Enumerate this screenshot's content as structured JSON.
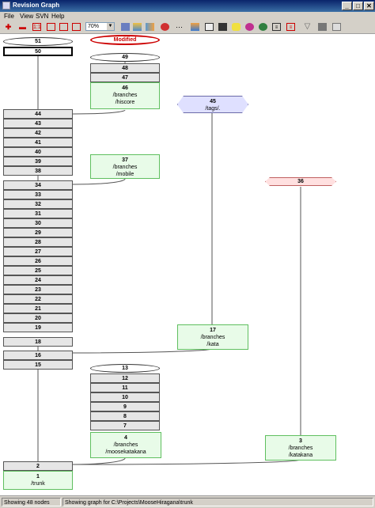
{
  "window": {
    "title": "Revision Graph",
    "controls": [
      "_",
      "□",
      "✕"
    ]
  },
  "menu": [
    "File",
    "View",
    "SVN",
    "Help"
  ],
  "toolbar": {
    "zoom": "70%"
  },
  "status": {
    "left": "Showing 48 nodes",
    "right": "Showing graph for C:\\Projects\\MooseHiragana\\trunk"
  },
  "colors": {
    "copy_fill": "#e8fbe8",
    "copy_border": "#5fbf5f",
    "modified": "#cc0000",
    "tag_fill": "#dfe0ff",
    "deleted_fill": "#ffe0e0"
  },
  "graph": {
    "modified_label": "Modified",
    "trunk_top": [
      "51",
      "50"
    ],
    "trunk_mid": [
      "44",
      "43",
      "42",
      "41",
      "40",
      "39",
      "38"
    ],
    "trunk_low": [
      "34",
      "33",
      "32",
      "31",
      "30",
      "29",
      "28",
      "27",
      "26",
      "25",
      "24",
      "23",
      "22",
      "21",
      "20",
      "19",
      "18"
    ],
    "trunk_bot": [
      "16",
      "15"
    ],
    "trunk_end": "2",
    "trunk_root": {
      "rev": "1",
      "path": "/trunk"
    },
    "hiscore_stack": [
      "49",
      "48",
      "47"
    ],
    "hiscore": {
      "rev": "46",
      "path1": "/branches",
      "path2": "/hiscore"
    },
    "mobile": {
      "rev": "37",
      "path1": "/branches",
      "path2": "/mobile"
    },
    "tag": {
      "rev": "45",
      "path": "/tags/."
    },
    "deleted": {
      "rev": "36"
    },
    "kata": {
      "rev": "17",
      "path1": "/branches",
      "path2": "/kata"
    },
    "moose_stack": [
      "13",
      "12",
      "11",
      "10",
      "9",
      "8",
      "7"
    ],
    "moose": {
      "rev": "4",
      "path1": "/branches",
      "path2": "/moosekatakana"
    },
    "katakana": {
      "rev": "3",
      "path1": "/branches",
      "path2": "/katakana"
    }
  }
}
